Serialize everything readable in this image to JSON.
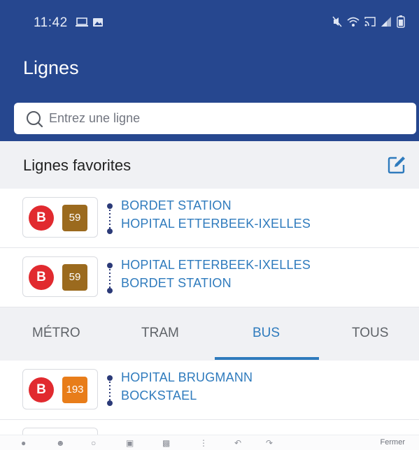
{
  "status_bar": {
    "time": "11:42",
    "left_icons": [
      "laptop-icon",
      "image-icon"
    ],
    "right_icons": [
      "mute-icon",
      "wifi-icon",
      "cast-icon",
      "signal-icon",
      "battery-icon"
    ]
  },
  "header": {
    "title": "Lignes"
  },
  "search": {
    "placeholder": "Entrez une ligne"
  },
  "favorites": {
    "title": "Lignes favorites",
    "items": [
      {
        "mode": "B",
        "line": "59",
        "line_color": "#9b6a1e",
        "from": "BORDET STATION",
        "to": "HOPITAL ETTERBEEK-IXELLES"
      },
      {
        "mode": "B",
        "line": "59",
        "line_color": "#9b6a1e",
        "from": "HOPITAL ETTERBEEK-IXELLES",
        "to": "BORDET STATION"
      }
    ]
  },
  "tabs": {
    "items": [
      {
        "label": "MÉTRO"
      },
      {
        "label": "TRAM"
      },
      {
        "label": "BUS"
      },
      {
        "label": "TOUS"
      }
    ],
    "active": "BUS"
  },
  "lines": {
    "items": [
      {
        "mode": "B",
        "line": "193",
        "line_color": "#e87d1a",
        "from": "HOPITAL BRUGMANN",
        "to": "BOCKSTAEL"
      }
    ]
  },
  "bottom_bar": {
    "close_label": "Fermer"
  },
  "colors": {
    "primary": "#26478f",
    "accent": "#2f7bbd",
    "bus_badge": "#e12a2f"
  }
}
